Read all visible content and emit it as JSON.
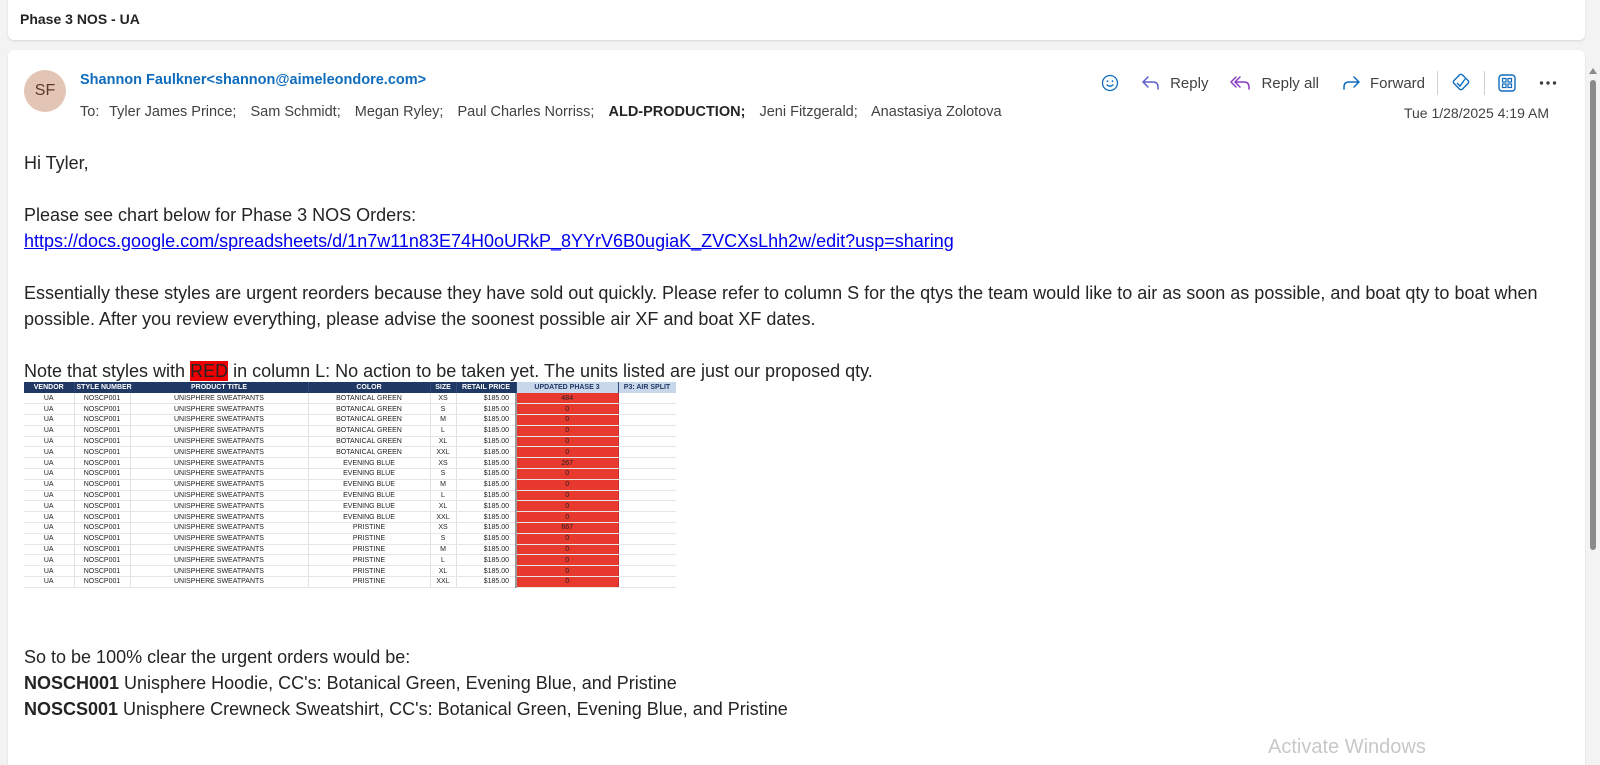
{
  "subject": "Phase 3 NOS - UA",
  "email": {
    "avatar_initials": "SF",
    "sender": "Shannon Faulkner<shannon@aimeleondore.com>",
    "to_label": "To:",
    "recipients": [
      "Tyler James Prince;",
      "Sam Schmidt;",
      "Megan Ryley;",
      "Paul Charles Norriss;",
      "ALD-PRODUCTION;",
      "Jeni Fitzgerald;",
      "Anastasiya Zolotova"
    ],
    "date": "Tue 1/28/2025 4:19 AM"
  },
  "actions": {
    "reply": "Reply",
    "reply_all": "Reply all",
    "forward": "Forward"
  },
  "body": {
    "greeting": "Hi Tyler,",
    "line1": "Please see chart below for Phase 3 NOS Orders:",
    "link": "https://docs.google.com/spreadsheets/d/1n7w11n83E74H0oURkP_8YYrV6B0ugiaK_ZVCXsLhh2w/edit?usp=sharing",
    "para2": "Essentially these styles are urgent reorders because they have sold out quickly. Please refer to column S for the qtys the team would like to air as soon as possible, and boat qty to boat when possible. After you review everything, please advise the soonest possible air XF and boat XF dates.",
    "note_before": "Note that styles with ",
    "note_red": "RED",
    "note_after": " in column L: No action to be taken yet. The units listed are just our proposed qty.",
    "summary_intro": "So to be 100% clear the urgent orders would be:",
    "order1_code": "NOSCH001",
    "order1_desc": " Unisphere Hoodie, CC's: Botanical Green, Evening Blue, and Pristine",
    "order2_code": "NOSCS001",
    "order2_desc": " Unisphere Crewneck Sweatshirt, CC's: Botanical Green, Evening Blue, and Pristine"
  },
  "sheet": {
    "headers": [
      "VENDOR",
      "STYLE NUMBER",
      "PRODUCT TITLE",
      "COLOR",
      "SIZE",
      "RETAIL PRICE",
      "UPDATED PHASE 3",
      "P3: AIR SPLIT"
    ],
    "rows": [
      [
        "UA",
        "NOSCP001",
        "UNISPHERE SWEATPANTS",
        "BOTANICAL GREEN",
        "XS",
        "$185.00",
        "484",
        ""
      ],
      [
        "UA",
        "NOSCP001",
        "UNISPHERE SWEATPANTS",
        "BOTANICAL GREEN",
        "S",
        "$185.00",
        "0",
        ""
      ],
      [
        "UA",
        "NOSCP001",
        "UNISPHERE SWEATPANTS",
        "BOTANICAL GREEN",
        "M",
        "$185.00",
        "0",
        ""
      ],
      [
        "UA",
        "NOSCP001",
        "UNISPHERE SWEATPANTS",
        "BOTANICAL GREEN",
        "L",
        "$185.00",
        "0",
        ""
      ],
      [
        "UA",
        "NOSCP001",
        "UNISPHERE SWEATPANTS",
        "BOTANICAL GREEN",
        "XL",
        "$185.00",
        "0",
        ""
      ],
      [
        "UA",
        "NOSCP001",
        "UNISPHERE SWEATPANTS",
        "BOTANICAL GREEN",
        "XXL",
        "$185.00",
        "0",
        ""
      ],
      [
        "UA",
        "NOSCP001",
        "UNISPHERE SWEATPANTS",
        "EVENING BLUE",
        "XS",
        "$185.00",
        "267",
        ""
      ],
      [
        "UA",
        "NOSCP001",
        "UNISPHERE SWEATPANTS",
        "EVENING BLUE",
        "S",
        "$185.00",
        "0",
        ""
      ],
      [
        "UA",
        "NOSCP001",
        "UNISPHERE SWEATPANTS",
        "EVENING BLUE",
        "M",
        "$185.00",
        "0",
        ""
      ],
      [
        "UA",
        "NOSCP001",
        "UNISPHERE SWEATPANTS",
        "EVENING BLUE",
        "L",
        "$185.00",
        "0",
        ""
      ],
      [
        "UA",
        "NOSCP001",
        "UNISPHERE SWEATPANTS",
        "EVENING BLUE",
        "XL",
        "$185.00",
        "0",
        ""
      ],
      [
        "UA",
        "NOSCP001",
        "UNISPHERE SWEATPANTS",
        "EVENING BLUE",
        "XXL",
        "$185.00",
        "0",
        ""
      ],
      [
        "UA",
        "NOSCP001",
        "UNISPHERE SWEATPANTS",
        "PRISTINE",
        "XS",
        "$185.00",
        "667",
        ""
      ],
      [
        "UA",
        "NOSCP001",
        "UNISPHERE SWEATPANTS",
        "PRISTINE",
        "S",
        "$185.00",
        "0",
        ""
      ],
      [
        "UA",
        "NOSCP001",
        "UNISPHERE SWEATPANTS",
        "PRISTINE",
        "M",
        "$185.00",
        "0",
        ""
      ],
      [
        "UA",
        "NOSCP001",
        "UNISPHERE SWEATPANTS",
        "PRISTINE",
        "L",
        "$185.00",
        "0",
        ""
      ],
      [
        "UA",
        "NOSCP001",
        "UNISPHERE SWEATPANTS",
        "PRISTINE",
        "XL",
        "$185.00",
        "0",
        ""
      ],
      [
        "UA",
        "NOSCP001",
        "UNISPHERE SWEATPANTS",
        "PRISTINE",
        "XXL",
        "$185.00",
        "0",
        ""
      ]
    ]
  },
  "watermark": "Activate Windows",
  "colors": {
    "accent": "#0f6cbd",
    "avatar_bg": "#e3c5b5",
    "red_highlight": "#ee0000",
    "sheet_header": "#1f3864",
    "sheet_red": "#e8392e"
  },
  "icons": [
    "emoji-icon",
    "reply-icon",
    "reply-all-icon",
    "forward-icon",
    "immersive-reader-icon",
    "apps-icon",
    "more-icon"
  ]
}
